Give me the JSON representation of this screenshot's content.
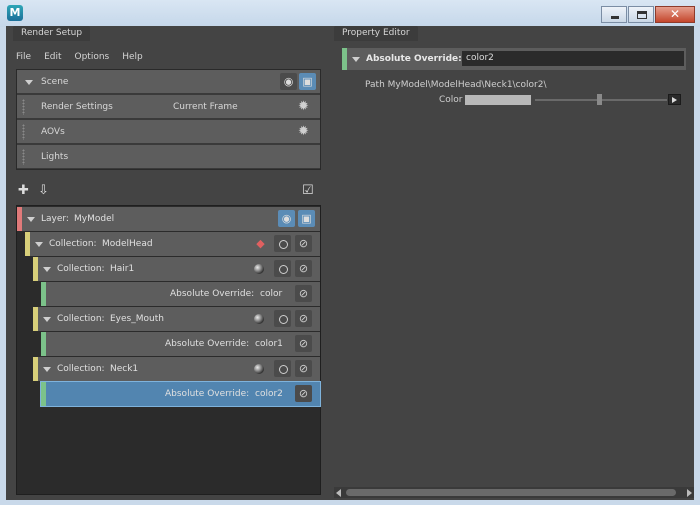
{
  "window": {
    "app_icon_letter": "M",
    "controls": [
      "minimize",
      "maximize",
      "close"
    ]
  },
  "render_setup": {
    "tab_label": "Render Setup",
    "menu": [
      "File",
      "Edit",
      "Options",
      "Help"
    ],
    "scene": {
      "label": "Scene",
      "rows": [
        {
          "label": "Render Settings",
          "value": "Current Frame"
        },
        {
          "label": "AOVs",
          "value": ""
        },
        {
          "label": "Lights",
          "value": ""
        }
      ]
    },
    "tree": {
      "layer": {
        "prefix": "Layer:",
        "name": "MyModel",
        "color": "#e07a7a"
      },
      "collection_color": "#d8cf7a",
      "override_color": "#7cc28a",
      "collection_prefix": "Collection:",
      "override_prefix": "Absolute Override:",
      "items": [
        {
          "kind": "collection",
          "name": "ModelHead"
        },
        {
          "kind": "collection",
          "name": "Hair1"
        },
        {
          "kind": "override",
          "name": "color"
        },
        {
          "kind": "collection",
          "name": "Eyes_Mouth"
        },
        {
          "kind": "override",
          "name": "color1"
        },
        {
          "kind": "collection",
          "name": "Neck1"
        },
        {
          "kind": "override",
          "name": "color2",
          "selected": true
        }
      ]
    }
  },
  "property_editor": {
    "tab_label": "Property Editor",
    "header_label": "Absolute Override:",
    "header_value": "color2",
    "path_label": "Path",
    "path_value": "MyModel\\ModelHead\\Neck1\\color2\\",
    "color_label": "Color",
    "swatch_color": "#b8b8b8"
  }
}
